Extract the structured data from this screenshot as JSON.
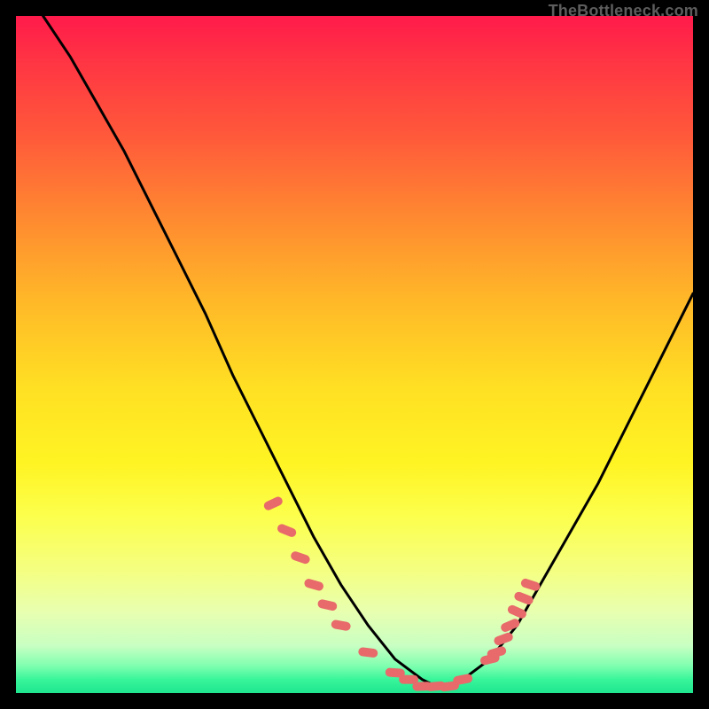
{
  "attribution": "TheBottleneck.com",
  "colors": {
    "curve": "#000000",
    "marker": "#e86a6a",
    "gradient_top": "#ff1a4b",
    "gradient_bottom": "#1ee68f"
  },
  "chart_data": {
    "type": "line",
    "title": "",
    "xlabel": "",
    "ylabel": "",
    "xlim": [
      0,
      100
    ],
    "ylim": [
      0,
      100
    ],
    "curve": {
      "x": [
        4,
        8,
        12,
        16,
        20,
        24,
        28,
        32,
        36,
        40,
        44,
        48,
        52,
        56,
        60,
        62,
        64,
        66,
        70,
        74,
        78,
        82,
        86,
        90,
        94,
        98,
        100
      ],
      "y": [
        100,
        94,
        87,
        80,
        72,
        64,
        56,
        47,
        39,
        31,
        23,
        16,
        10,
        5,
        2,
        1,
        1,
        2,
        5,
        10,
        17,
        24,
        31,
        39,
        47,
        55,
        59
      ]
    },
    "markers": {
      "x": [
        38,
        40,
        42,
        44,
        46,
        48,
        52,
        56,
        58,
        60,
        62,
        64,
        66,
        70,
        71,
        72,
        73,
        74,
        75,
        76
      ],
      "y": [
        28,
        24,
        20,
        16,
        13,
        10,
        6,
        3,
        2,
        1,
        1,
        1,
        2,
        5,
        6,
        8,
        10,
        12,
        14,
        16
      ]
    }
  }
}
